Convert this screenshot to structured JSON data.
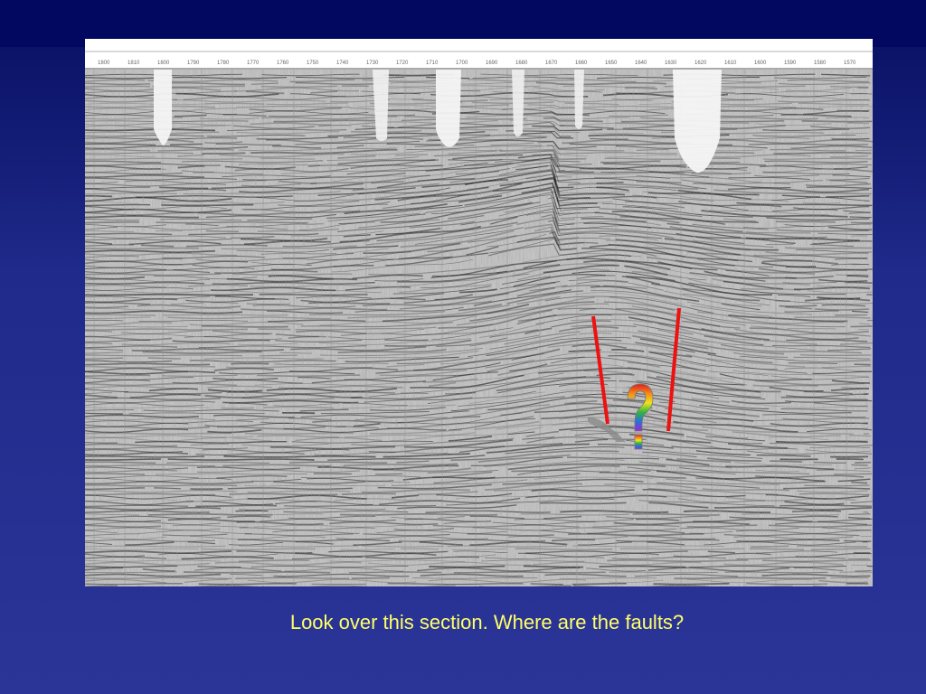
{
  "slide": {
    "caption": "Look over this section. Where are the faults?",
    "background_color": "#2b3598",
    "caption_color": "#ffff66"
  },
  "seismic_section": {
    "image_type": "seismic-reflection-profile",
    "shotpoint_labels": [
      "1800",
      "1810",
      "1800",
      "1790",
      "1780",
      "1770",
      "1760",
      "1750",
      "1740",
      "1730",
      "1720",
      "1710",
      "1700",
      "1690",
      "1680",
      "1670",
      "1660",
      "1650",
      "1640",
      "1630",
      "1620",
      "1610",
      "1600",
      "1590",
      "1580",
      "1570"
    ],
    "fault_color": "#ee1111",
    "marker_icon": "rainbow-question-mark-icon"
  }
}
